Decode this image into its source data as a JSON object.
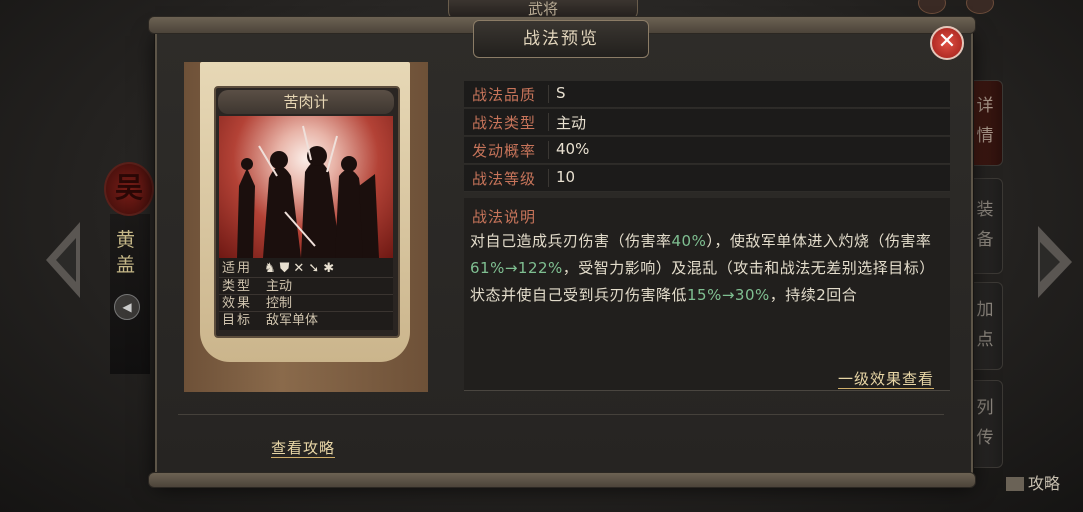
{
  "background": {
    "top_tab": "武将",
    "hero_faction": "吴",
    "hero_name": "黄盖",
    "audio_icon": "speaker-icon",
    "side_tabs": [
      {
        "label": "详情",
        "active": true
      },
      {
        "label": "装备",
        "active": false
      },
      {
        "label": "加点",
        "active": false
      },
      {
        "label": "列传",
        "active": false
      }
    ],
    "guide_label": "攻略"
  },
  "dialog": {
    "title": "战法预览",
    "close_icon": "close-icon",
    "card": {
      "name": "苦肉计",
      "rows": [
        {
          "key": "适用",
          "value": ""
        },
        {
          "key": "类型",
          "value": "主动"
        },
        {
          "key": "效果",
          "value": "控制"
        },
        {
          "key": "目标",
          "value": "敌军单体"
        }
      ],
      "troop_icons": [
        "cavalry-icon",
        "shield-icon",
        "bow-icon",
        "spear-icon",
        "wheel-icon"
      ]
    },
    "stats": [
      {
        "key": "战法品质",
        "value": "S"
      },
      {
        "key": "战法类型",
        "value": "主动"
      },
      {
        "key": "发动概率",
        "value": "40%"
      },
      {
        "key": "战法等级",
        "value": "10"
      }
    ],
    "description": {
      "heading": "战法说明",
      "parts": [
        {
          "t": "对自己造成兵刃伤害（伤害率",
          "hl": false
        },
        {
          "t": "40%",
          "hl": true
        },
        {
          "t": "），使敌军单体进入灼烧（伤害率",
          "hl": false
        },
        {
          "t": "61%→122%",
          "hl": true
        },
        {
          "t": "，受智力影响）及混乱（攻击和战法无差别选择目标）状态并使自己受到兵刃伤害降低",
          "hl": false
        },
        {
          "t": "15%→30%",
          "hl": true
        },
        {
          "t": "，持续2回合",
          "hl": false
        }
      ]
    },
    "first_level_link": "一级效果查看",
    "guide_link": "查看攻略"
  }
}
